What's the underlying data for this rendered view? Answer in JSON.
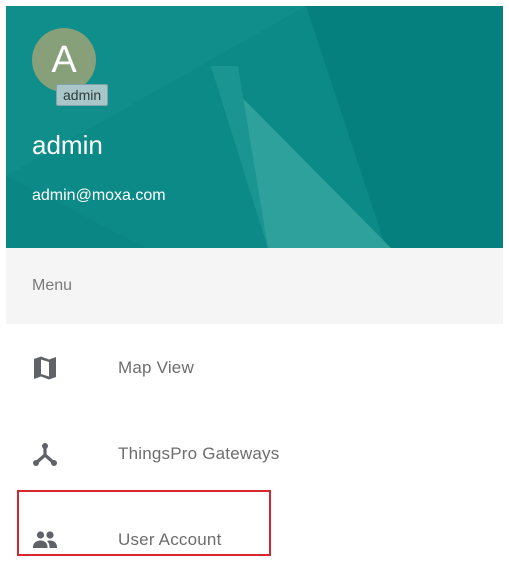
{
  "header": {
    "avatar_initial": "A",
    "avatar_tooltip": "admin",
    "user_name": "admin",
    "user_email": "admin@moxa.com",
    "background_color": "#0b8a87"
  },
  "menu": {
    "title": "Menu",
    "items": [
      {
        "label": "Map View",
        "icon": "map-icon"
      },
      {
        "label": "ThingsPro Gateways",
        "icon": "gateway-icon"
      },
      {
        "label": "User Account",
        "icon": "people-icon",
        "highlighted": true
      }
    ]
  },
  "colors": {
    "accent": "#0b8a87",
    "highlight": "#d7262e",
    "menu_bg": "#f5f5f5"
  }
}
